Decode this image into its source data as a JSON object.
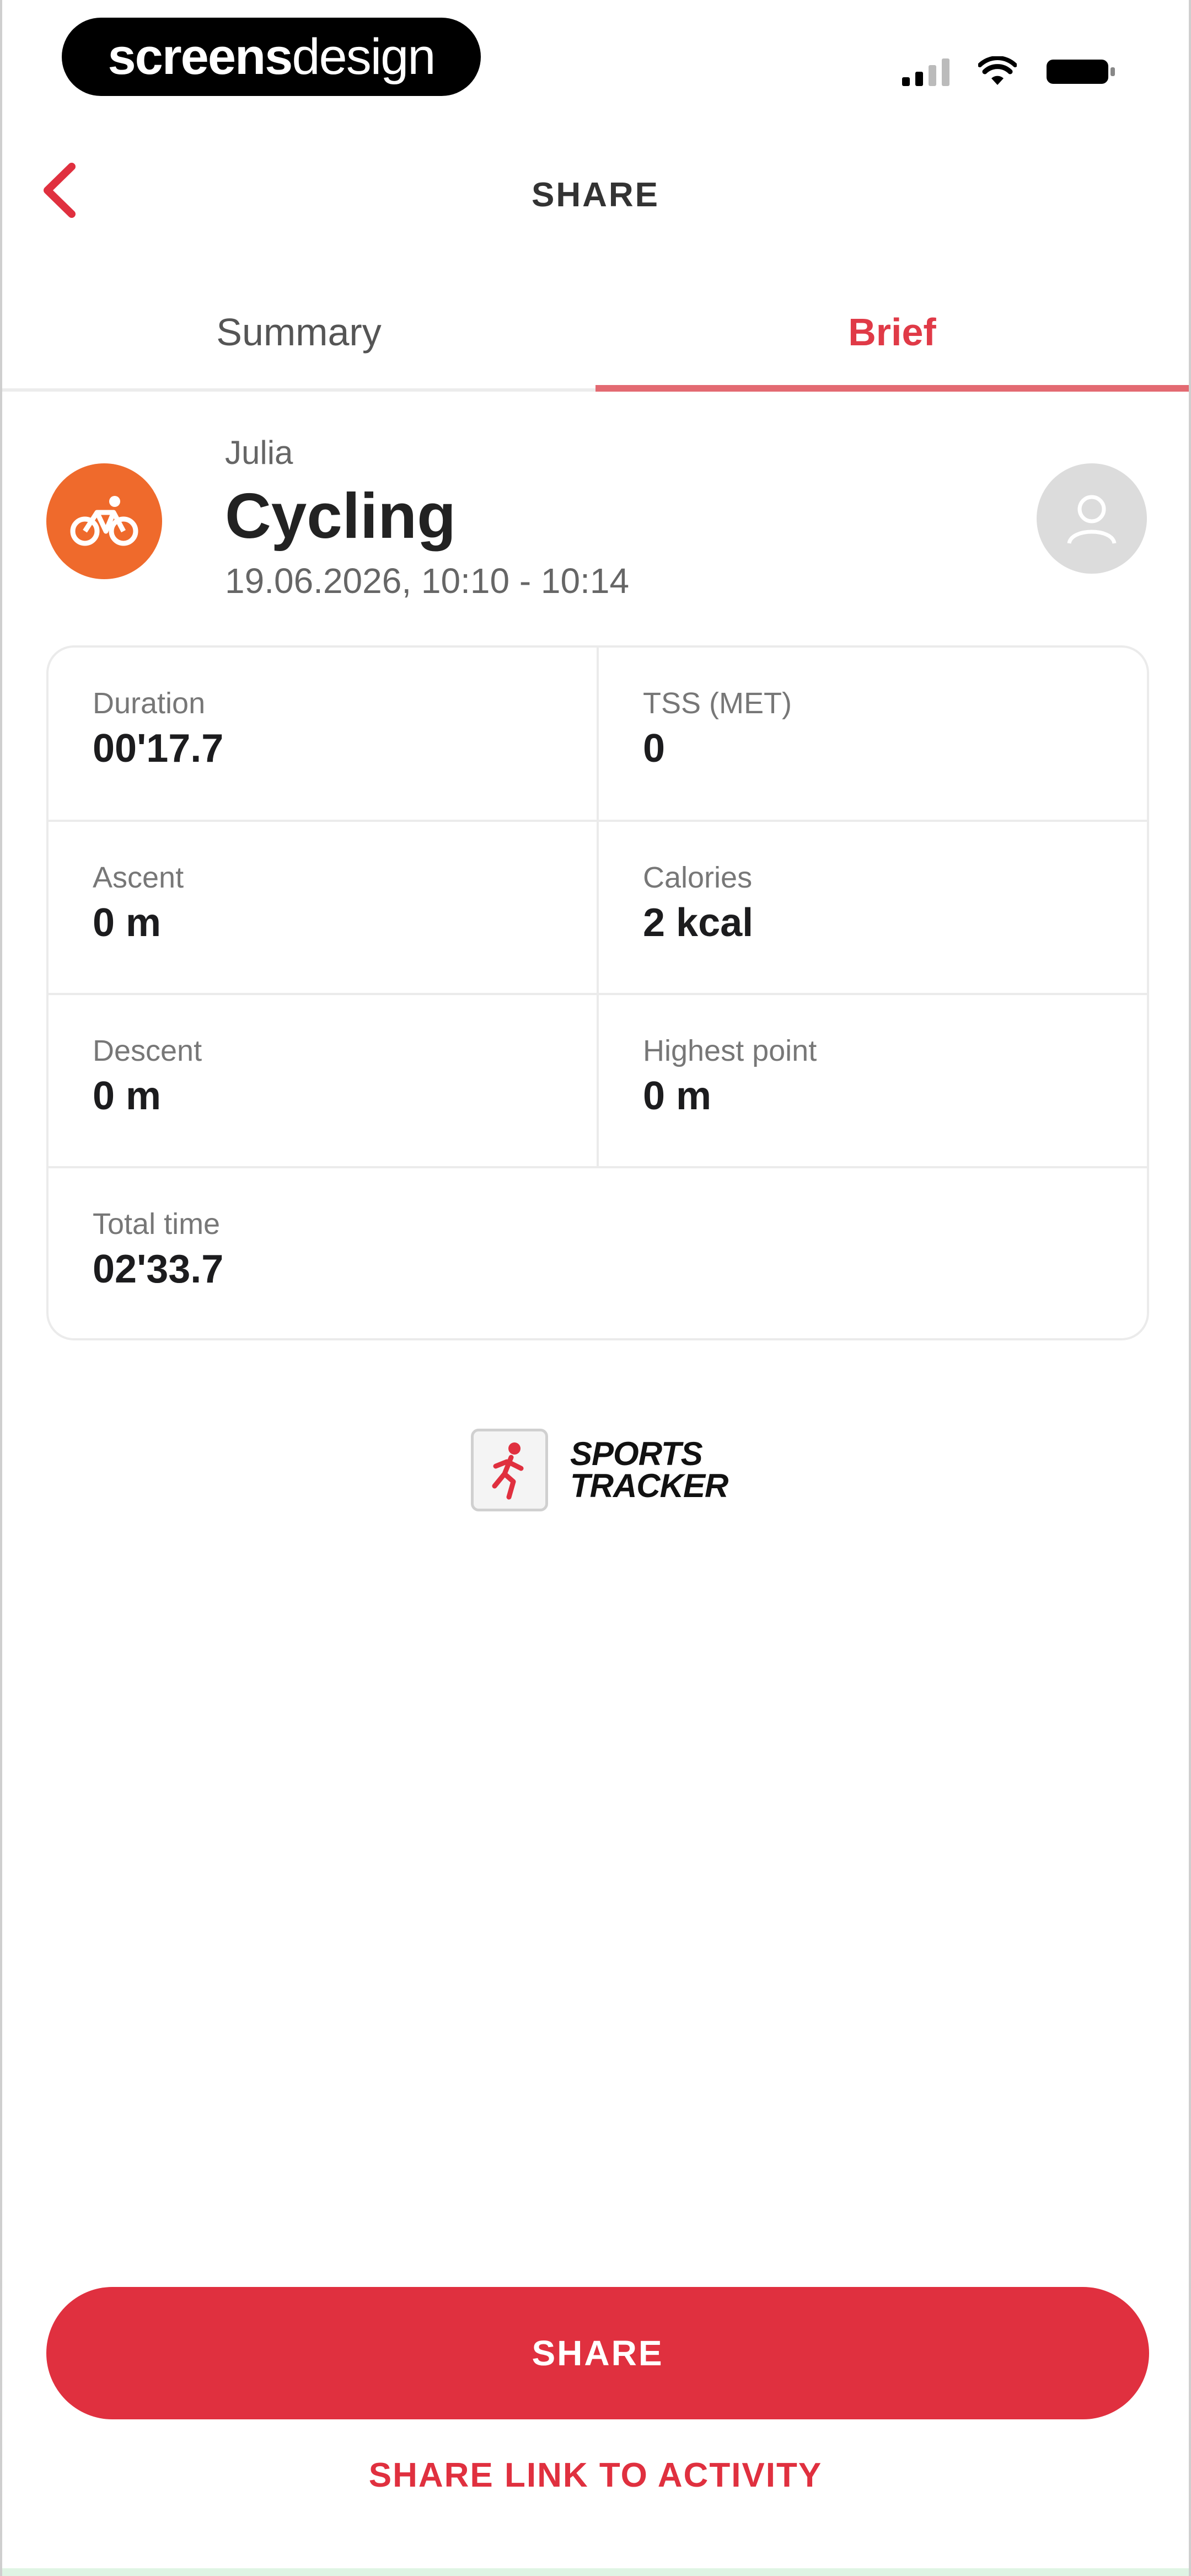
{
  "status_bar": {
    "brand": {
      "part1": "screens",
      "part2": "design"
    },
    "signal_icon": "cellular-signal-icon",
    "wifi_icon": "wifi-icon",
    "battery_icon": "battery-icon"
  },
  "header": {
    "back_icon": "chevron-left-icon",
    "title": "SHARE"
  },
  "tabs": [
    {
      "label": "Summary",
      "active": false
    },
    {
      "label": "Brief",
      "active": true
    }
  ],
  "activity": {
    "icon": "bicycle-icon",
    "user": "Julia",
    "type": "Cycling",
    "date_range": "19.06.2026, 10:10 - 10:14",
    "avatar_icon": "user-avatar-icon",
    "accent_color": "#ef6a2c"
  },
  "stats": [
    {
      "label": "Duration",
      "value": "00'17.7"
    },
    {
      "label": "TSS (MET)",
      "value": "0"
    },
    {
      "label": "Ascent",
      "value": "0 m"
    },
    {
      "label": "Calories",
      "value": "2 kcal"
    },
    {
      "label": "Descent",
      "value": "0 m"
    },
    {
      "label": "Highest point",
      "value": "0 m"
    },
    {
      "label": "Total time",
      "value": "02'33.7"
    }
  ],
  "logo": {
    "line1": "SPORTS",
    "line2": "TRACKER",
    "icon": "running-figure-icon"
  },
  "actions": {
    "share_label": "SHARE",
    "share_link_label": "SHARE LINK TO ACTIVITY",
    "primary_color": "#e0303f"
  }
}
